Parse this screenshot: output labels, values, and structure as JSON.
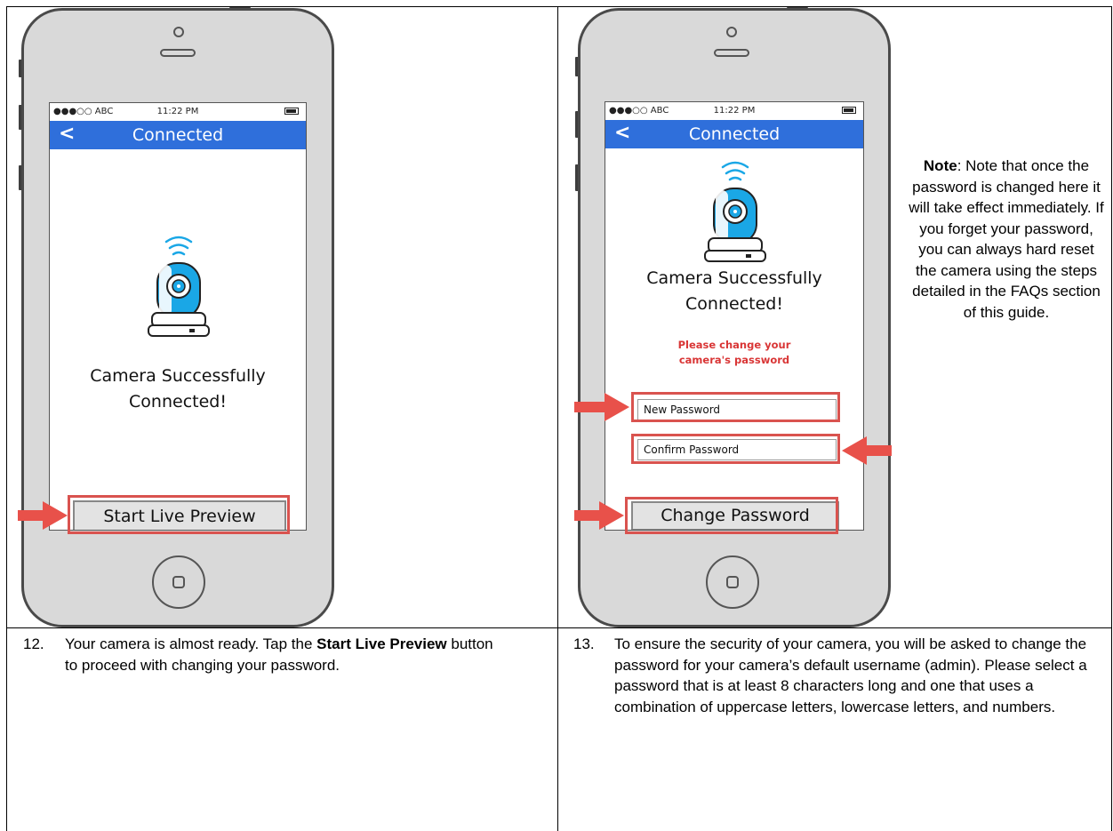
{
  "left_phone": {
    "status": {
      "carrier": "●●●○○ ABC",
      "time": "11:22 PM"
    },
    "nav": {
      "back": "<",
      "title": "Connected"
    },
    "message_line1": "Camera Successfully",
    "message_line2": "Connected!",
    "button": "Start Live Preview"
  },
  "right_phone": {
    "status": {
      "carrier": "●●●○○ ABC",
      "time": "11:22 PM"
    },
    "nav": {
      "back": "<",
      "title": "Connected"
    },
    "message_line1": "Camera Successfully",
    "message_line2": "Connected!",
    "warning_line1": "Please change your",
    "warning_line2": "camera's password",
    "new_password_placeholder": "New Password",
    "confirm_password_placeholder": "Confirm Password",
    "button": "Change Password"
  },
  "note": {
    "label": "Note",
    "text": ": Note that once the password is changed here it will take effect immediately. If you forget your password, you can always hard reset the camera using the steps detailed in the FAQs section of this guide."
  },
  "step12": {
    "number": "12.",
    "text_before": "Your camera is almost ready. Tap the ",
    "bold": "Start Live Preview",
    "text_after": " button to proceed with changing your password."
  },
  "step13": {
    "number": "13.",
    "text": "To ensure the security of your camera, you will be asked to change the password for your camera’s default username (admin). Please select a password that is at least 8 characters long and one that uses a combination of uppercase letters, lowercase letters, and numbers."
  },
  "colors": {
    "nav_blue": "#2f6fdb",
    "highlight_red": "#d9534f",
    "warning_red": "#d93636",
    "camera_blue": "#1aa7e6"
  },
  "icons": [
    "wifi-icon",
    "camera-icon",
    "arrow-right-icon",
    "arrow-left-icon",
    "home-button-icon"
  ]
}
